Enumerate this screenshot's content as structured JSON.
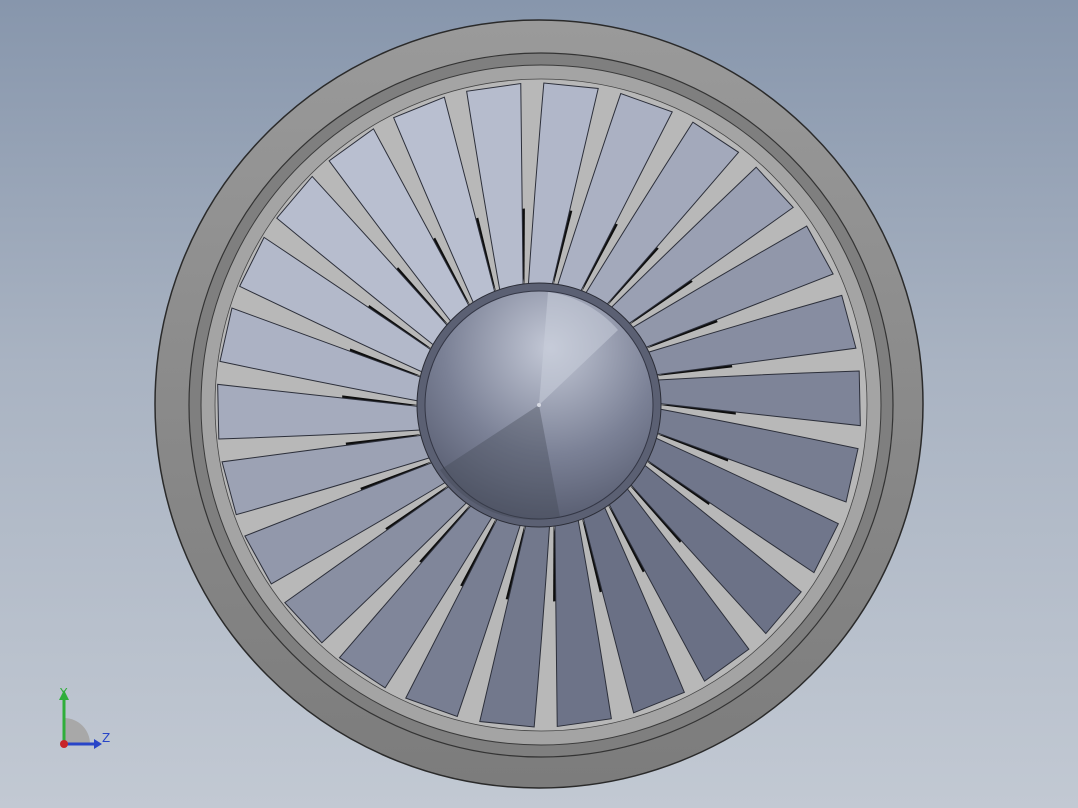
{
  "viewport": {
    "background_top": "#8796ac",
    "background_bottom": "#c2c9d3"
  },
  "model": {
    "name": "fan",
    "blade_count": 26,
    "colors": {
      "casing": "#8e8e8e",
      "casing_dark": "#5c5c5c",
      "blade_light": "#b9bfd0",
      "blade_dark": "#6a7085",
      "hub_light": "#b4b9c8",
      "hub_dark": "#4e5366",
      "gap": "#0e0e0e"
    }
  },
  "triad": {
    "y_label": "Y",
    "z_label": "Z",
    "y_color": "#2fae3a",
    "z_color": "#2845c8",
    "x_color": "#c8242a"
  }
}
